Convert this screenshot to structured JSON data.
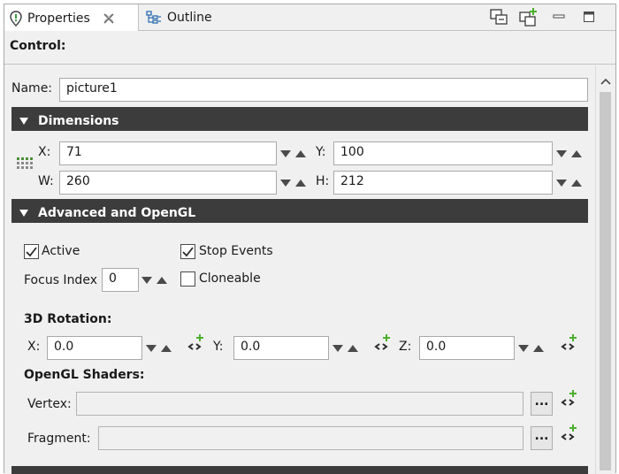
{
  "tabs": {
    "properties_label": "Properties",
    "outline_label": "Outline"
  },
  "header": {
    "title": "Control:"
  },
  "name": {
    "label": "Name:",
    "value": "picture1"
  },
  "dimensions": {
    "title": "Dimensions",
    "x_label": "X:",
    "x_value": "71",
    "y_label": "Y:",
    "y_value": "100",
    "w_label": "W:",
    "w_value": "260",
    "h_label": "H:",
    "h_value": "212"
  },
  "advanced": {
    "title": "Advanced and OpenGL",
    "active_label": "Active",
    "active_checked": true,
    "stop_events_label": "Stop Events",
    "stop_events_checked": true,
    "focus_index_label": "Focus Index",
    "focus_index_value": "0",
    "cloneable_label": "Cloneable",
    "cloneable_checked": false
  },
  "rotation": {
    "title": "3D Rotation:",
    "x_label": "X:",
    "x_value": "0.0",
    "y_label": "Y:",
    "y_value": "0.0",
    "z_label": "Z:",
    "z_value": "0.0"
  },
  "shaders": {
    "title": "OpenGL Shaders:",
    "vertex_label": "Vertex:",
    "vertex_value": "",
    "fragment_label": "Fragment:",
    "fragment_value": "",
    "browse_label": "..."
  },
  "colors": {
    "section_bar": "#3c3c3c",
    "green_plus": "#4caf2e",
    "outline_blue": "#2b6cb0"
  },
  "icons": [
    "properties-icon",
    "close-icon",
    "outline-icon",
    "view-menu-icon",
    "new-view-icon",
    "minimize-icon",
    "maximize-icon",
    "collapse-triangle-icon",
    "grid-icon",
    "spinner-down-icon",
    "spinner-up-icon",
    "checkmark-icon",
    "add-link-icon",
    "scroll-up-icon"
  ]
}
